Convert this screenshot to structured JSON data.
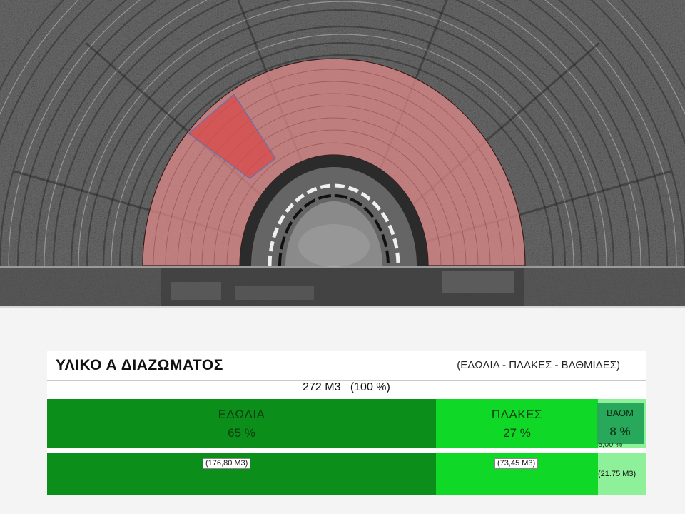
{
  "image": {
    "description_icon": "theatre-aerial-photo",
    "highlight_color": "#e48b8b",
    "highlight_sector_color": "#d9494a"
  },
  "table": {
    "title": "ΥΛΙΚΟ Α ΔΙΑΖΩΜΑΤΟΣ",
    "subtitle": "(ΕΔΩΛΙΑ - ΠΛΑΚΕΣ - ΒΑΘΜΙΔΕΣ)",
    "total": "272 Μ3   (100 %)",
    "segments": [
      {
        "label": "ΕΔΩΛΙΑ",
        "percent": "65 %",
        "volume": "(176,80 Μ3)",
        "share": 0.65,
        "color": "#0c8f1a"
      },
      {
        "label": "ΠΛΑΚΕΣ",
        "percent": "27 %",
        "volume": "(73,45 Μ3)",
        "share": 0.27,
        "color": "#10d826"
      },
      {
        "label": "ΒΑΘΜ",
        "percent": "8 %",
        "volume": "(21.75 Μ3)",
        "share": 0.08,
        "color": "#8ff09a",
        "tag_color": "#27a85a",
        "overlap_text": "8,00 %"
      }
    ]
  }
}
